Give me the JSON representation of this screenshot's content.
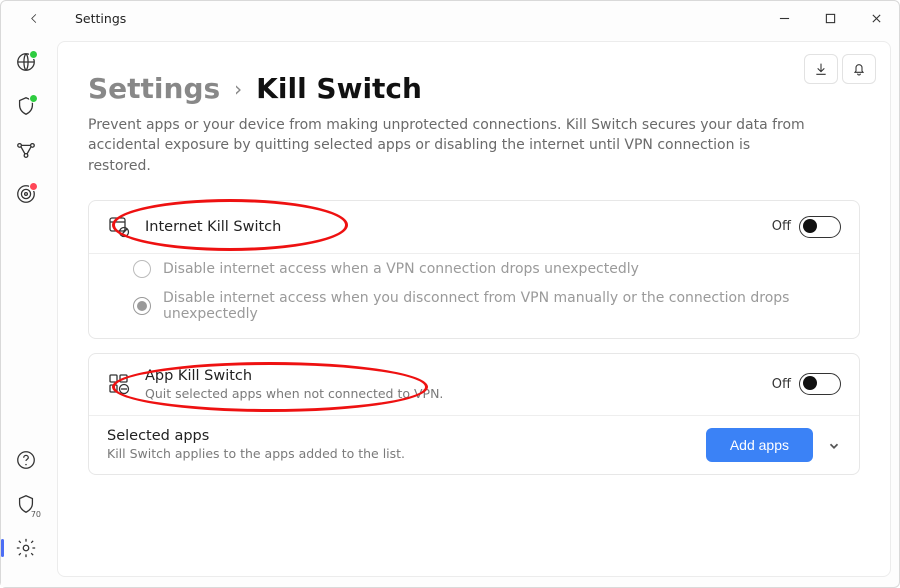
{
  "titlebar": {
    "title": "Settings"
  },
  "breadcrumb": {
    "parent": "Settings",
    "separator": "›",
    "current": "Kill Switch"
  },
  "description": "Prevent apps or your device from making unprotected connections. Kill Switch secures your data from accidental exposure by quitting selected apps or disabling the internet until VPN connection is restored.",
  "internetKill": {
    "title": "Internet Kill Switch",
    "state": "Off",
    "options": [
      {
        "label": "Disable internet access when a VPN connection drops unexpectedly",
        "selected": false
      },
      {
        "label": "Disable internet access when you disconnect from VPN manually or the connection drops unexpectedly",
        "selected": true
      }
    ]
  },
  "appKill": {
    "title": "App Kill Switch",
    "subtitle": "Quit selected apps when not connected to VPN.",
    "state": "Off"
  },
  "selectedApps": {
    "title": "Selected apps",
    "subtitle": "Kill Switch applies to the apps added to the list.",
    "button": "Add apps"
  },
  "sidebar": {
    "badge": "70"
  }
}
